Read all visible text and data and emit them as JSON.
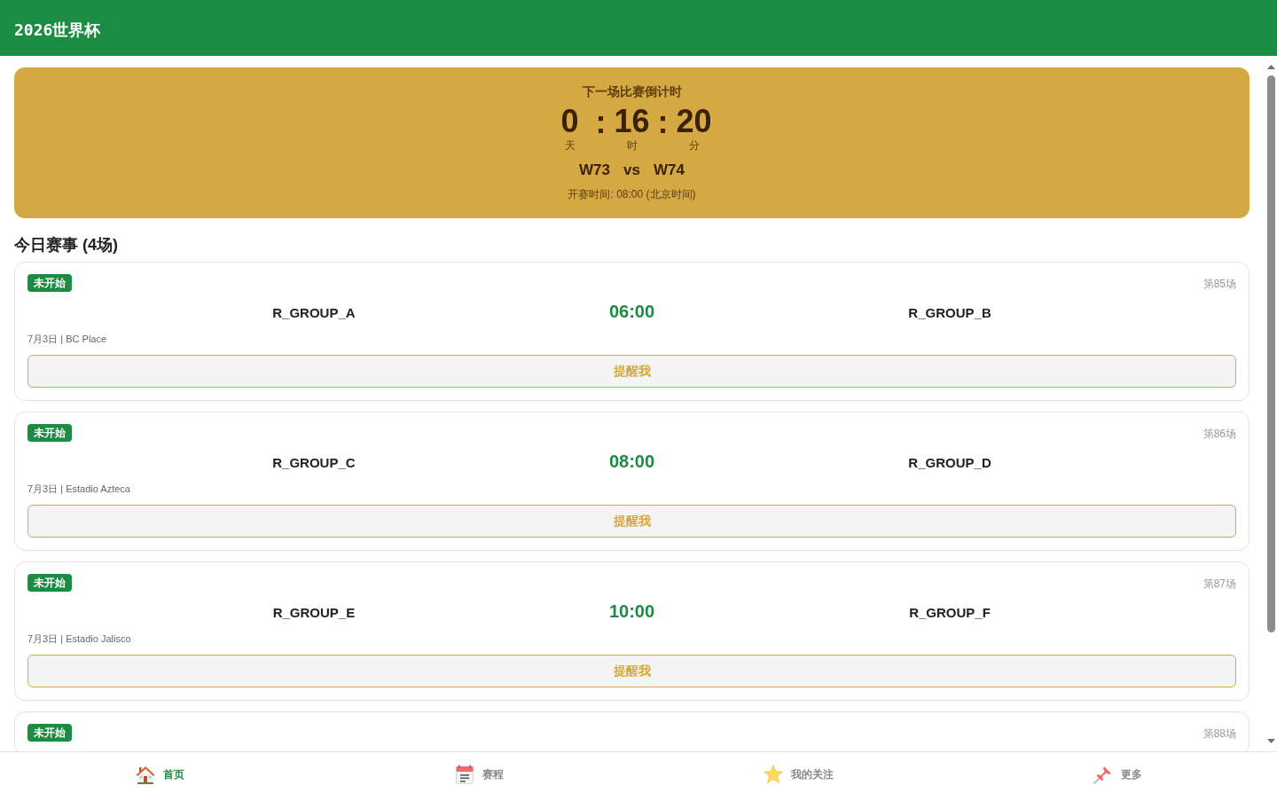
{
  "header": {
    "title": "2026世界杯"
  },
  "countdown": {
    "title": "下一场比赛倒计时",
    "units": [
      {
        "value": "0",
        "unit": "天"
      },
      {
        "value": "16",
        "unit": "时"
      },
      {
        "value": "20",
        "unit": "分"
      }
    ],
    "separators": [
      ":",
      ":"
    ],
    "home": "W73",
    "vs": "vs",
    "away": "W74",
    "kickoff": "开赛时间: 08:00 (北京时间)"
  },
  "section_title": "今日赛事 (4场)",
  "matches": [
    {
      "status": "未开始",
      "number": "第85场",
      "home": "R_GROUP_A",
      "time": "06:00",
      "away": "R_GROUP_B",
      "info": "7月3日 | BC Place",
      "button": "提醒我"
    },
    {
      "status": "未开始",
      "number": "第86场",
      "home": "R_GROUP_C",
      "time": "08:00",
      "away": "R_GROUP_D",
      "info": "7月3日 | Estadio Azteca",
      "button": "提醒我"
    },
    {
      "status": "未开始",
      "number": "第87场",
      "home": "R_GROUP_E",
      "time": "10:00",
      "away": "R_GROUP_F",
      "info": "7月3日 | Estadio Jalisco",
      "button": "提醒我"
    },
    {
      "status": "未开始",
      "number": "第88场"
    }
  ],
  "nav": [
    {
      "label": "首页",
      "selected": true
    },
    {
      "label": "赛程",
      "selected": false
    },
    {
      "label": "我的关注",
      "selected": false
    },
    {
      "label": "更多",
      "selected": false
    }
  ]
}
